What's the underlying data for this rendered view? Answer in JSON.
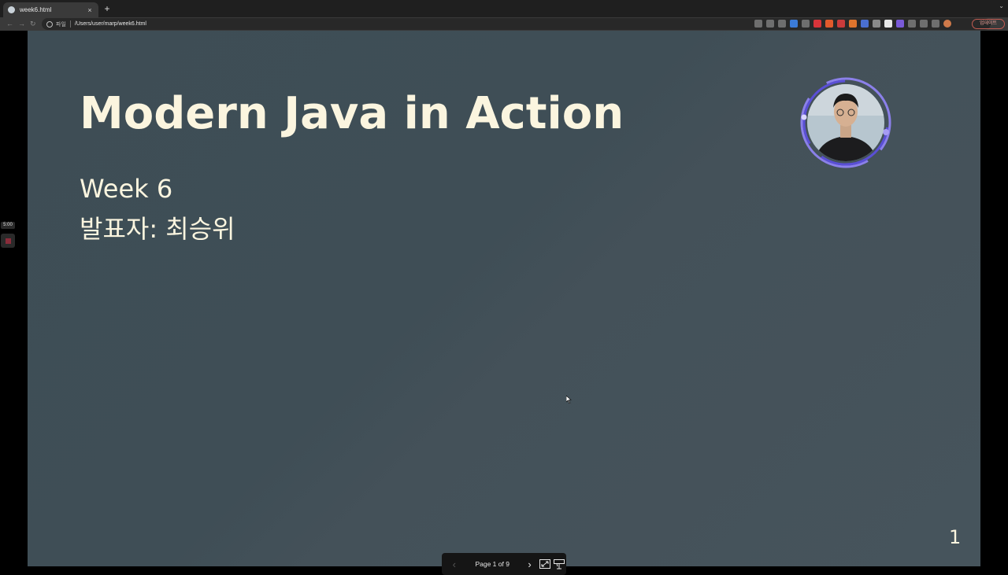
{
  "browser": {
    "tab_title": "week6.html",
    "tab_close": "×",
    "new_tab": "+",
    "scheme_label": "파일",
    "url": "/Users/user/marp/week6.html",
    "profile_label": "업데이트"
  },
  "sidebar": {
    "timer": "5:00"
  },
  "slide": {
    "title": "Modern Java in Action",
    "week": "Week 6",
    "presenter": "발표자: 최승위",
    "page_number": "1"
  },
  "controls": {
    "prev": "‹",
    "page_info": "Page 1 of 9",
    "next": "›"
  },
  "colors": {
    "slide_bg": "#3f4e56",
    "slide_text": "#fbf5df",
    "avatar_ring": "#7b6fe6"
  }
}
